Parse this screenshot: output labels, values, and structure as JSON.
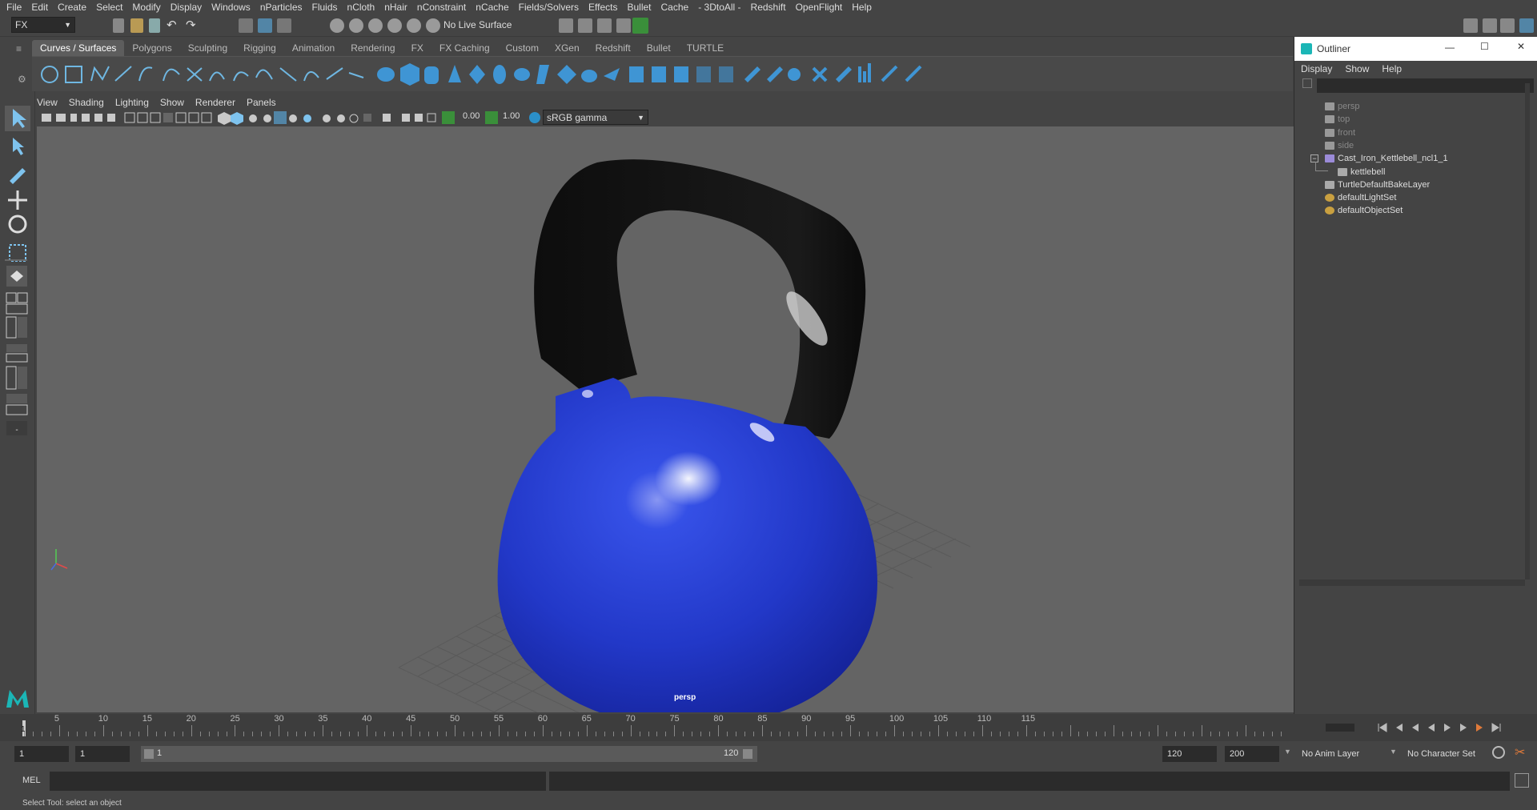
{
  "menubar": [
    "File",
    "Edit",
    "Create",
    "Select",
    "Modify",
    "Display",
    "Windows",
    "nParticles",
    "Fluids",
    "nCloth",
    "nHair",
    "nConstraint",
    "nCache",
    "Fields/Solvers",
    "Effects",
    "Bullet",
    "Cache",
    "- 3DtoAll -",
    "Redshift",
    "OpenFlight",
    "Help"
  ],
  "toolbar": {
    "menuset": "FX",
    "live_surface": "No Live Surface"
  },
  "shelf_tabs": [
    "Curves / Surfaces",
    "Polygons",
    "Sculpting",
    "Rigging",
    "Animation",
    "Rendering",
    "FX",
    "FX Caching",
    "Custom",
    "XGen",
    "Redshift",
    "Bullet",
    "TURTLE"
  ],
  "viewport": {
    "menu": [
      "View",
      "Shading",
      "Lighting",
      "Show",
      "Renderer",
      "Panels"
    ],
    "exposure": "0.00",
    "gamma": "1.00",
    "color_space": "sRGB gamma",
    "camera_label": "persp"
  },
  "outliner": {
    "title": "Outliner",
    "menu": [
      "Display",
      "Show",
      "Help"
    ],
    "items": [
      {
        "label": "persp",
        "kind": "camera",
        "dim": true
      },
      {
        "label": "top",
        "kind": "camera",
        "dim": true
      },
      {
        "label": "front",
        "kind": "camera",
        "dim": true
      },
      {
        "label": "side",
        "kind": "camera",
        "dim": true
      },
      {
        "label": "Cast_Iron_Kettlebell_ncl1_1",
        "kind": "group",
        "dim": false
      },
      {
        "label": "kettlebell",
        "kind": "mesh",
        "dim": false
      },
      {
        "label": "TurtleDefaultBakeLayer",
        "kind": "layer",
        "dim": false
      },
      {
        "label": "defaultLightSet",
        "kind": "set",
        "dim": false
      },
      {
        "label": "defaultObjectSet",
        "kind": "set",
        "dim": false
      }
    ]
  },
  "timeline": {
    "ticks": [
      "5",
      "10",
      "15",
      "20",
      "25",
      "30",
      "35",
      "40",
      "45",
      "50",
      "55",
      "60",
      "65",
      "70",
      "75",
      "80",
      "85",
      "90",
      "95",
      "100",
      "105",
      "110",
      "115"
    ],
    "current_frame": "1"
  },
  "range": {
    "start": "1",
    "playback_start": "1",
    "slider_start": "1",
    "slider_end": "120",
    "playback_end": "120",
    "end": "200",
    "anim_layer": "No Anim Layer",
    "character_set": "No Character Set"
  },
  "cmd": {
    "language": "MEL"
  },
  "help_text": "Select Tool: select an object",
  "colors": {
    "accent": "#5285a6",
    "kettlebell_blue": "#2d45d8",
    "handle": "#141414",
    "viewport_bg": "#646464"
  }
}
